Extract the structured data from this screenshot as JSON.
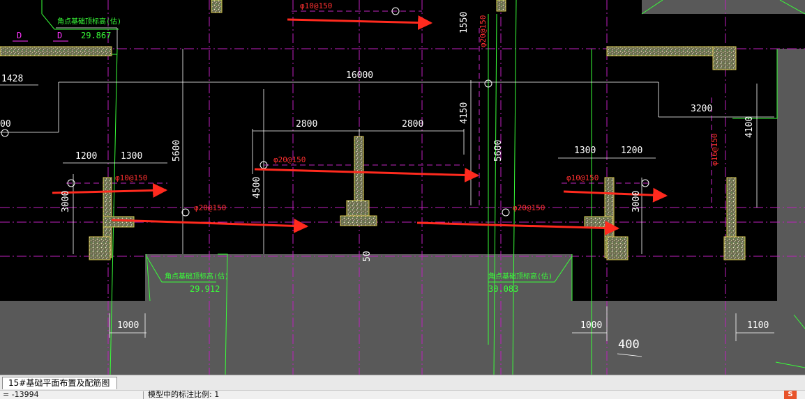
{
  "drawing": {
    "dimensions": [
      "16000",
      "2800",
      "2800",
      "1300",
      "1200",
      "1300",
      "1200",
      "5600",
      "5600",
      "4500",
      "4150",
      "1550",
      "3200",
      "4100",
      "3000",
      "3000",
      "1428",
      "1000",
      "1000",
      "1100",
      "400",
      "50"
    ],
    "rebar_labels": [
      "φ10@150",
      "φ10@150",
      "φ10@150",
      "φ20@150",
      "φ20@150",
      "φ20@150",
      "φ20@150",
      "φ16@150"
    ],
    "elevation_titles": [
      "角点基础顶标高(估)",
      "角点基础顶标高(估)",
      "角点基础顶标高(估)"
    ],
    "elevation_values": [
      "29.867",
      "29.912",
      "30.083"
    ],
    "section_tags": [
      "D",
      "D"
    ],
    "partial_text": "00"
  },
  "colors": {
    "background": "#000000",
    "outer_area": "#595959",
    "dimension": "#ffffff",
    "elevation": "#39ff39",
    "gridline": "#ff33ff",
    "rebar": "#ff3030",
    "foundation": "#c8c8a0",
    "arrow": "#ff2a1e"
  },
  "tabs": {
    "active": "15#基础平面布置及配筋图"
  },
  "status": {
    "coordinate": "= -13994",
    "scale_text": "模型中的标注比例: 1",
    "ime_icon": "S"
  }
}
